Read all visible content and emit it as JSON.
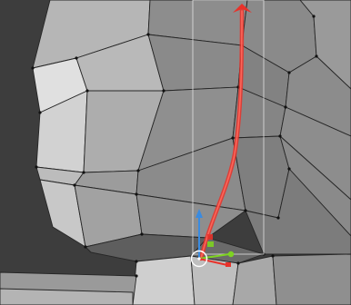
{
  "viewport": {
    "background_color": "#3d3d3d",
    "mesh_light_color": "#d4d4d4",
    "mesh_mid_color": "#a9a9a9",
    "mesh_dark_color": "#707070",
    "edge_color": "#262626",
    "vertex_color": "#111111",
    "stroke_color": "#e8322a",
    "selection_box_color": "#e6e6e6"
  },
  "gizmo": {
    "icon": "transform-gizmo-icon",
    "x_axis_color": "#e8322a",
    "y_axis_color": "#7ed321",
    "z_axis_color": "#3a8be0",
    "pivot_color": "#ffffff"
  }
}
